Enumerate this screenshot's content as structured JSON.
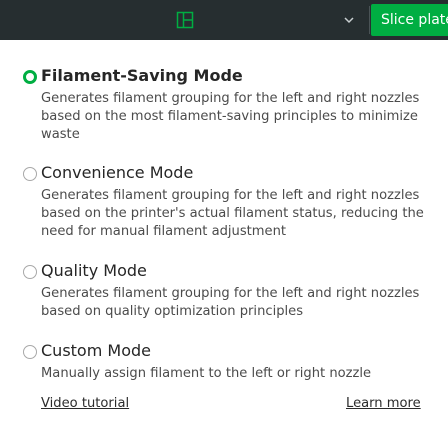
{
  "toolbar": {
    "layout_icon": "layout-icon",
    "chevron_icon": "chevron-down-icon",
    "slice_label": "Slice plate",
    "accent_color": "#00ae42",
    "background_color": "#262e30"
  },
  "modes": [
    {
      "title": "Filament-Saving Mode",
      "description": "Generates filament grouping for the left and right nozzles based on the most filament-saving principles to minimize waste",
      "selected": true
    },
    {
      "title": "Convenience Mode",
      "description": "Generates filament grouping for the left and right nozzles based on the printer's actual filament status, reducing the need for manual filament adjustment",
      "selected": false
    },
    {
      "title": "Quality Mode",
      "description": "Generates filament grouping for the left and right nozzles based on quality optimization principles",
      "selected": false
    },
    {
      "title": "Custom Mode",
      "description": "Manually assign filament to the left or right nozzle",
      "selected": false
    }
  ],
  "footer": {
    "video_tutorial": "Video tutorial",
    "learn_more": "Learn more"
  }
}
